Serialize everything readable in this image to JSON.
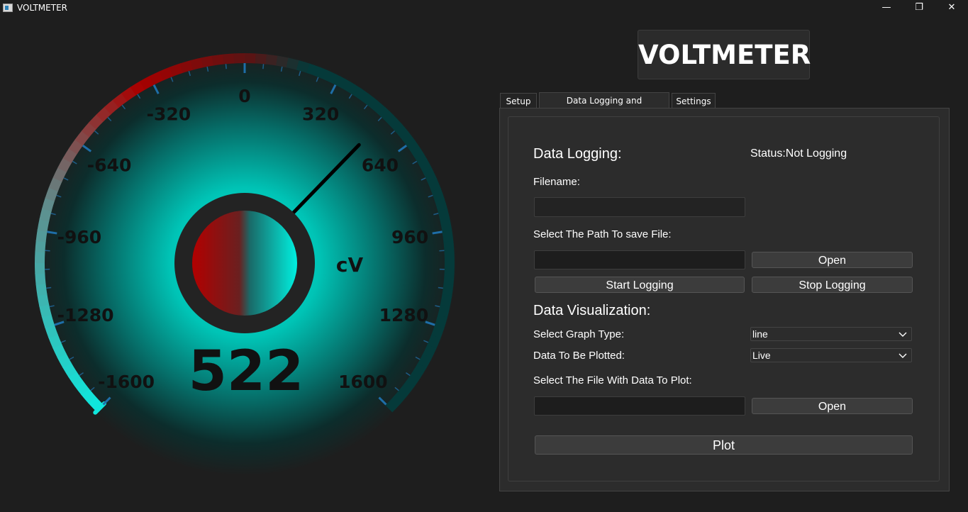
{
  "window": {
    "title": "VOLTMETER",
    "controls": {
      "minimize": "—",
      "maximize": "❐",
      "close": "✕"
    }
  },
  "gauge": {
    "value": "522",
    "unit": "cV",
    "scale_labels": [
      "-1600",
      "-1280",
      "-960",
      "-640",
      "-320",
      "0",
      "320",
      "640",
      "960",
      "1280",
      "1600"
    ],
    "min": -1600,
    "max": 1600,
    "needle_value": 522,
    "colors": {
      "low_accent": "#00f0e0",
      "high_accent": "#b80000",
      "needle": "#000000",
      "text": "#111111"
    }
  },
  "logo": {
    "text": "VOLTMETER"
  },
  "tabs": [
    {
      "label": "Setup",
      "active": false
    },
    {
      "label": "Data Logging and Visualization",
      "active": true
    },
    {
      "label": "Settings",
      "active": false
    }
  ],
  "logging": {
    "heading": "Data Logging:",
    "status": "Status:Not Logging",
    "filename_label": "Filename:",
    "filename_value": "",
    "path_label": "Select The Path To save File:",
    "path_value": "",
    "open_label": "Open",
    "start_label": "Start Logging",
    "stop_label": "Stop Logging"
  },
  "visualization": {
    "heading": "Data Visualization:",
    "graph_type_label": "Select Graph Type:",
    "graph_type_value": "line",
    "data_label": "Data To Be Plotted:",
    "data_value": "Live",
    "file_label": "Select The File With Data To Plot:",
    "file_value": "",
    "open_label": "Open",
    "plot_label": "Plot"
  }
}
